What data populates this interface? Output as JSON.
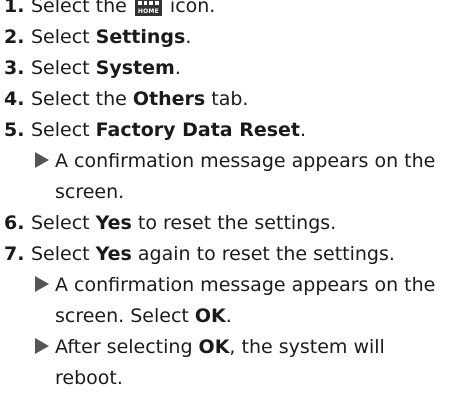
{
  "steps": [
    {
      "num": "1.",
      "pre": "Select the ",
      "icon_name": "home-icon",
      "icon_label": "HOME",
      "post": " icon."
    },
    {
      "num": "2.",
      "pre": "Select ",
      "bold": "Settings",
      "post": "."
    },
    {
      "num": "3.",
      "pre": "Select ",
      "bold": "System",
      "post": "."
    },
    {
      "num": "4.",
      "pre": "Select the ",
      "bold": "Others",
      "post": " tab."
    },
    {
      "num": "5.",
      "pre": "Select ",
      "bold": "Factory Data Reset",
      "post": ".",
      "result": {
        "line1": "A confirmation message appears on the",
        "line2": "screen."
      }
    },
    {
      "num": "6.",
      "pre": "Select ",
      "bold": "Yes",
      "post": " to reset the settings."
    },
    {
      "num": "7.",
      "pre": "Select ",
      "bold": "Yes",
      "post": " again to reset the settings.",
      "results": [
        {
          "line1": "A confirmation message appears on the",
          "line2_pre": "screen. Select ",
          "line2_bold": "OK",
          "line2_post": "."
        },
        {
          "line1_pre": "After selecting ",
          "line1_bold": "OK",
          "line1_post": ", the system will",
          "line2": "reboot."
        }
      ]
    }
  ],
  "colors": {
    "text": "#1a1a1a",
    "arrow": "#555555",
    "icon_bg": "#333333"
  }
}
